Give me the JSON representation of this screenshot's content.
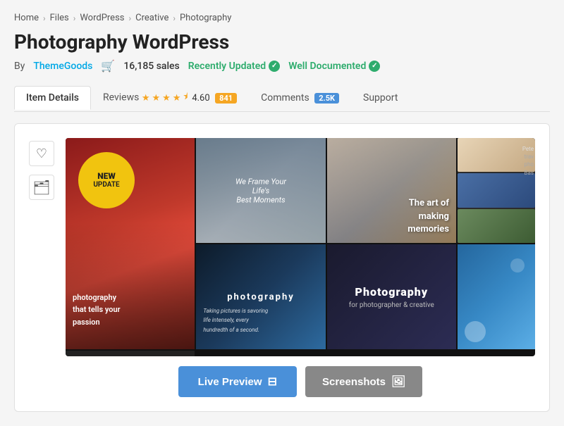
{
  "breadcrumb": {
    "items": [
      "Home",
      "Files",
      "WordPress",
      "Creative",
      "Photography"
    ]
  },
  "page": {
    "title": "Photography WordPress",
    "author_label": "By",
    "author_name": "ThemeGoods",
    "sales_count": "16,185 sales",
    "recently_updated": "Recently Updated",
    "well_documented": "Well Documented"
  },
  "tabs": {
    "item_details": "Item Details",
    "reviews": "Reviews",
    "rating": "4.60",
    "review_count": "841",
    "comments": "Comments",
    "comment_count": "2.5K",
    "support": "Support"
  },
  "collage": {
    "new_update": "NEW\nUPDATE",
    "tagline_1": "photography\nthat tells your\npassion",
    "tagline_2": "We Frame Your Life's Best Moments",
    "art_text": "The art of\nmaking\nmemories",
    "photo_label": "photography",
    "footer_text": "Photography",
    "footer_sub": "for photographer & creative",
    "taking_pictures": "Taking pictures is savoring\nlife intensely, every\nhundredth of a second.",
    "sidebar_name1": "Pete",
    "sidebar_detail1": "trav\npho\nBas",
    "sidebar_name2": "Pete\nJoh"
  },
  "buttons": {
    "live_preview": "Live Preview",
    "screenshots": "Screenshots"
  },
  "icons": {
    "heart": "♡",
    "folder": "🗂",
    "cart": "🛒",
    "monitor": "⊟",
    "image": "⊟"
  }
}
